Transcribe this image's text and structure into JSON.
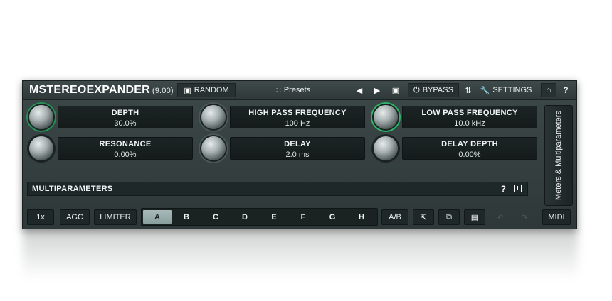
{
  "header": {
    "title": "MSTEREOEXPANDER",
    "version": "(9.00)",
    "random_label": "RANDOM",
    "presets_label": "Presets",
    "bypass_label": "BYPASS",
    "settings_label": "SETTINGS",
    "help_label": "?"
  },
  "params": [
    {
      "name": "DEPTH",
      "value": "30.0%"
    },
    {
      "name": "HIGH PASS FREQUENCY",
      "value": "100 Hz"
    },
    {
      "name": "LOW PASS FREQUENCY",
      "value": "10.0 kHz"
    },
    {
      "name": "RESONANCE",
      "value": "0.00%"
    },
    {
      "name": "DELAY",
      "value": "2.0 ms"
    },
    {
      "name": "DELAY DEPTH",
      "value": "0.00%"
    }
  ],
  "multiparameters": {
    "label": "MULTIPARAMETERS",
    "help_label": "?"
  },
  "side_tab": {
    "label": "Meters & Multiparameters"
  },
  "footer": {
    "speed_label": "1x",
    "agc_label": "AGC",
    "limiter_label": "LIMITER",
    "slots": [
      "A",
      "B",
      "C",
      "D",
      "E",
      "F",
      "G",
      "H"
    ],
    "active_slot": "A",
    "ab_label": "A/B",
    "midi_label": "MIDI"
  },
  "icons": {
    "random": "cube-icon",
    "presets": "grid-icon",
    "prev": "triangle-left-icon",
    "next": "triangle-right-icon",
    "bypass": "power-icon",
    "settings": "wrench-icon",
    "home": "home-icon"
  },
  "colors": {
    "accent_ring": "#2bb56a",
    "panel": "#364242",
    "active_slot": "#9fb2b1"
  }
}
